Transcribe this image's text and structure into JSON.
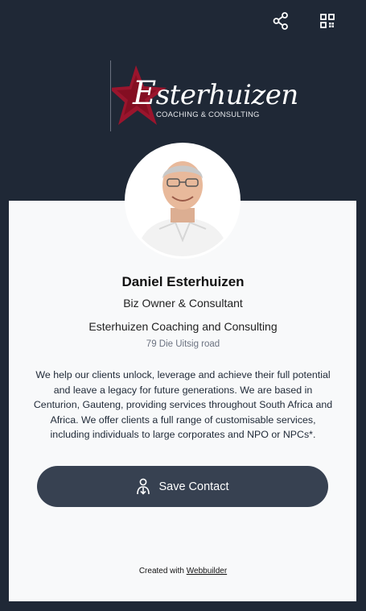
{
  "header": {
    "icons": [
      "share-icon",
      "qr-code-icon"
    ]
  },
  "logo": {
    "script_first": "E",
    "script_rest": "sterhuizen",
    "tagline": "COACHING & CONSULTING",
    "accent_color": "#b0122c"
  },
  "profile": {
    "name": "Daniel Esterhuizen",
    "role": "Biz Owner & Consultant",
    "company": "Esterhuizen Coaching and Consulting",
    "address": "79 Die Uitsig road",
    "bio": "We help our clients unlock, leverage and achieve their full potential and leave a legacy for future generations. We are based in Centurion, Gauteng, providing services throughout South Africa and Africa. We offer clients a full range of customisable services, including individuals to large corporates and NPO or NPCs*."
  },
  "actions": {
    "save_contact_label": "Save Contact",
    "save_contact_icon": "person-download-icon"
  },
  "footer": {
    "prefix": "Created with",
    "link_label": "Webbuilder"
  },
  "colors": {
    "background": "#1f2836",
    "card": "#f8f9fa",
    "button": "#374151"
  }
}
